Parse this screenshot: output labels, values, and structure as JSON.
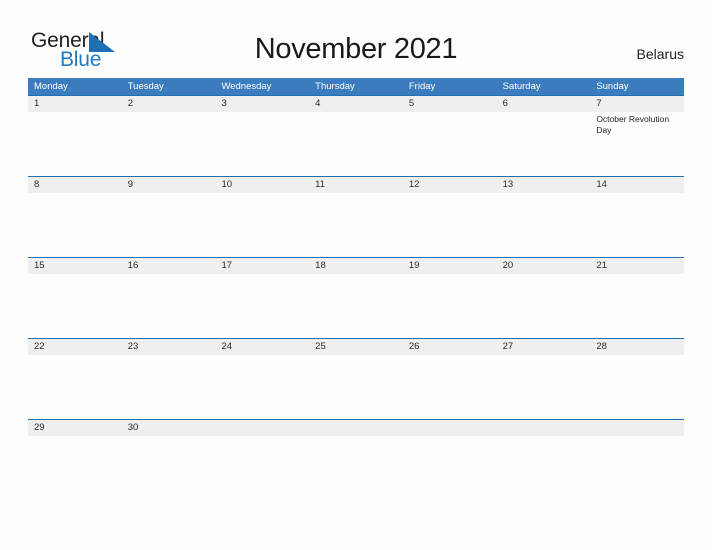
{
  "brand": {
    "name_part1": "General",
    "name_part2": "Blue",
    "triangle_color": "#1f6fb2",
    "blue_color": "#1f7ac4",
    "dark_color": "#231f20"
  },
  "header": {
    "title": "November 2021",
    "country": "Belarus"
  },
  "theme": {
    "header_blue": "#3a7cbd",
    "divider_blue": "#1f6fb2",
    "band_gray": "#efefef",
    "page_background": "#fdfdfd"
  },
  "calendar": {
    "weekdays": [
      "Monday",
      "Tuesday",
      "Wednesday",
      "Thursday",
      "Friday",
      "Saturday",
      "Sunday"
    ],
    "weeks": [
      [
        {
          "date": "1",
          "event": ""
        },
        {
          "date": "2",
          "event": ""
        },
        {
          "date": "3",
          "event": ""
        },
        {
          "date": "4",
          "event": ""
        },
        {
          "date": "5",
          "event": ""
        },
        {
          "date": "6",
          "event": ""
        },
        {
          "date": "7",
          "event": "October Revolution Day"
        }
      ],
      [
        {
          "date": "8",
          "event": ""
        },
        {
          "date": "9",
          "event": ""
        },
        {
          "date": "10",
          "event": ""
        },
        {
          "date": "11",
          "event": ""
        },
        {
          "date": "12",
          "event": ""
        },
        {
          "date": "13",
          "event": ""
        },
        {
          "date": "14",
          "event": ""
        }
      ],
      [
        {
          "date": "15",
          "event": ""
        },
        {
          "date": "16",
          "event": ""
        },
        {
          "date": "17",
          "event": ""
        },
        {
          "date": "18",
          "event": ""
        },
        {
          "date": "19",
          "event": ""
        },
        {
          "date": "20",
          "event": ""
        },
        {
          "date": "21",
          "event": ""
        }
      ],
      [
        {
          "date": "22",
          "event": ""
        },
        {
          "date": "23",
          "event": ""
        },
        {
          "date": "24",
          "event": ""
        },
        {
          "date": "25",
          "event": ""
        },
        {
          "date": "26",
          "event": ""
        },
        {
          "date": "27",
          "event": ""
        },
        {
          "date": "28",
          "event": ""
        }
      ],
      [
        {
          "date": "29",
          "event": ""
        },
        {
          "date": "30",
          "event": ""
        },
        {
          "date": "",
          "event": ""
        },
        {
          "date": "",
          "event": ""
        },
        {
          "date": "",
          "event": ""
        },
        {
          "date": "",
          "event": ""
        },
        {
          "date": "",
          "event": ""
        }
      ]
    ]
  }
}
